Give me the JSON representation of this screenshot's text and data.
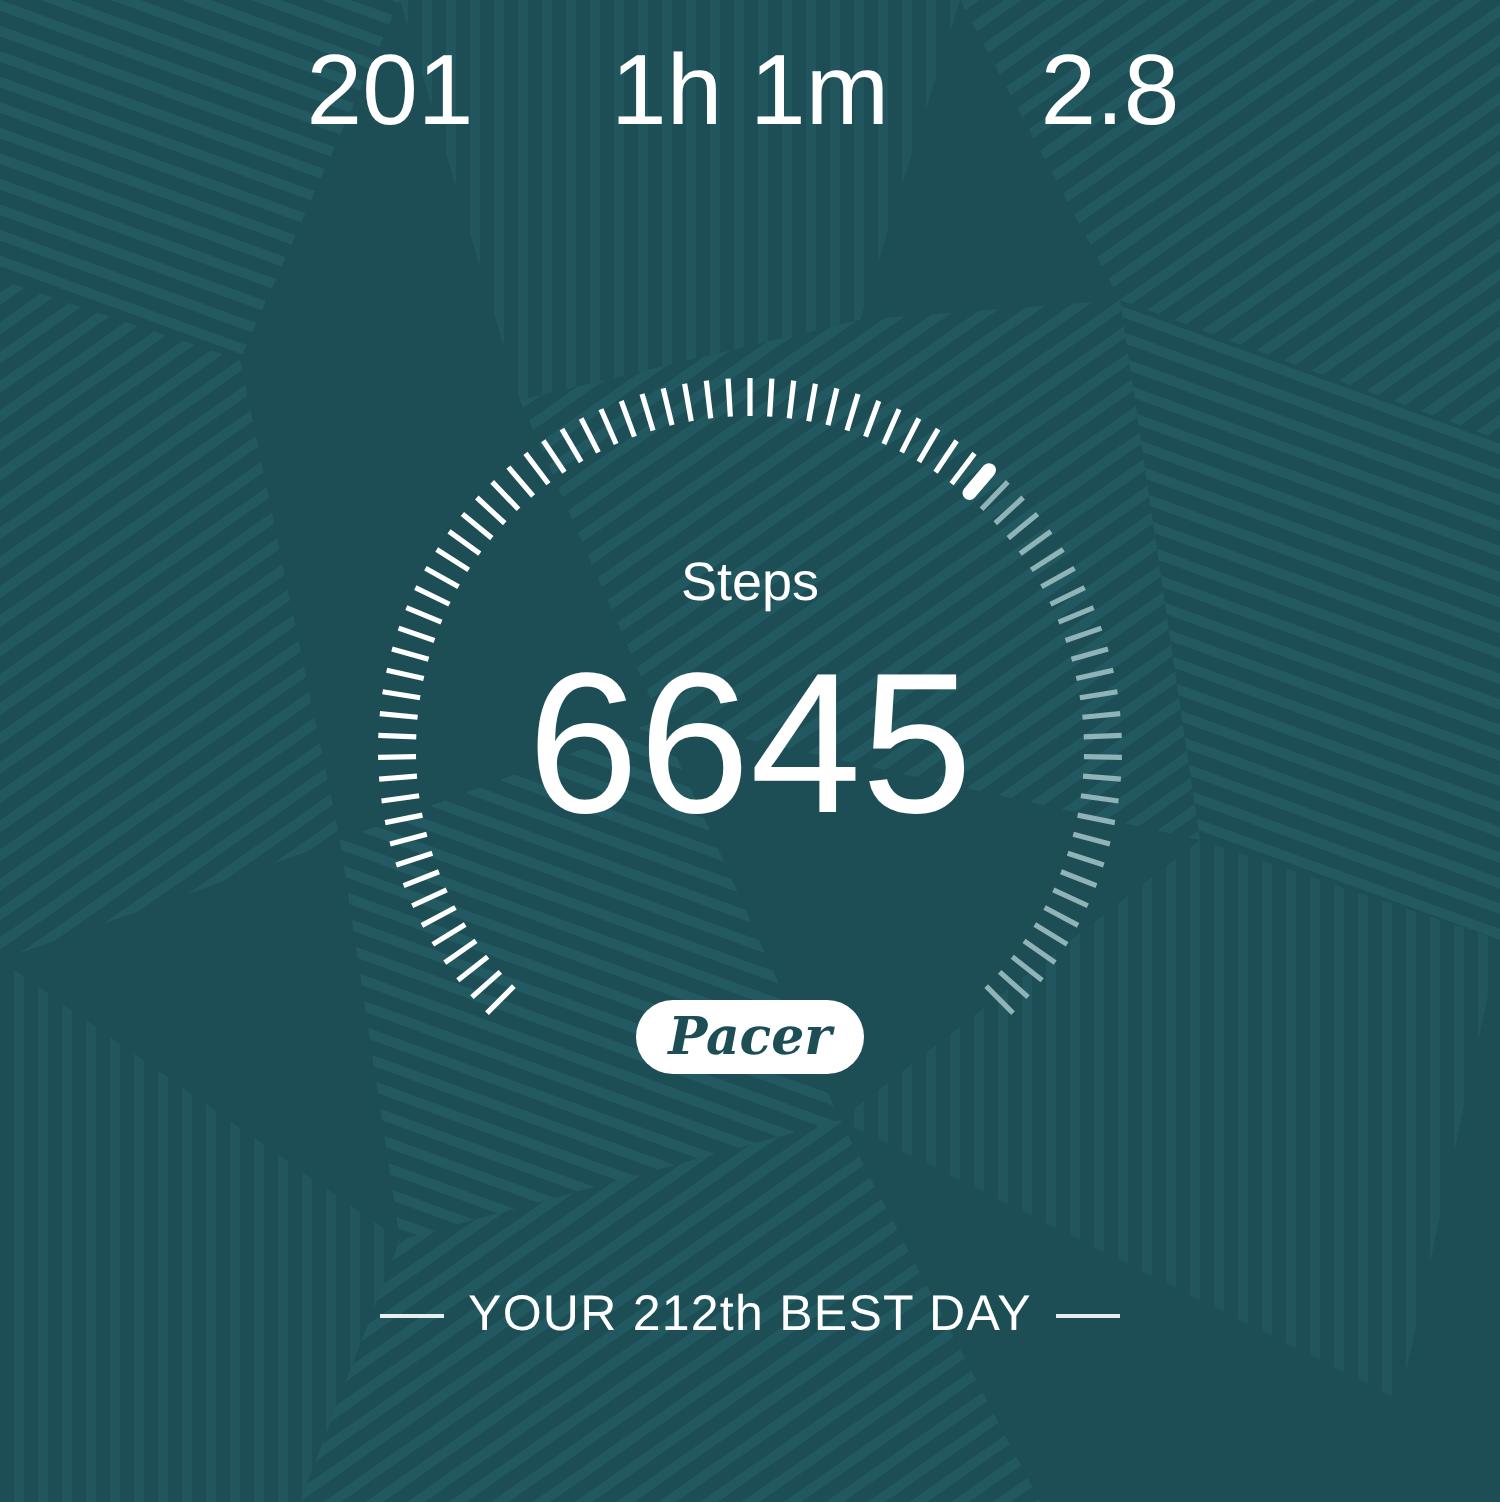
{
  "stats": [
    {
      "value": "201"
    },
    {
      "value": "1h 1m"
    },
    {
      "value": "2.8"
    }
  ],
  "gauge": {
    "label": "Steps",
    "value": "6645"
  },
  "logo": {
    "text": "Pacer"
  },
  "footer": {
    "text": "YOUR 212th BEST DAY"
  }
}
